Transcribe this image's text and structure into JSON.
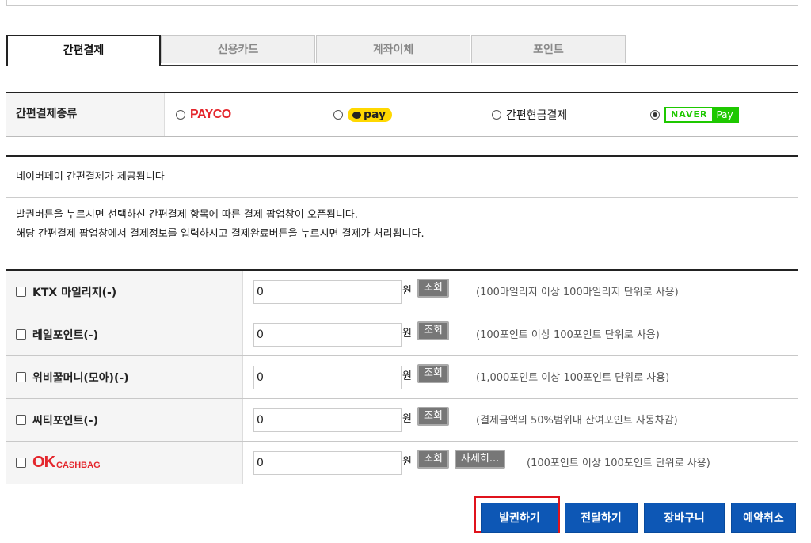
{
  "tabs": [
    {
      "label": "간편결제",
      "active": true
    },
    {
      "label": "신용카드",
      "active": false
    },
    {
      "label": "계좌이체",
      "active": false
    },
    {
      "label": "포인트",
      "active": false
    }
  ],
  "pay_type": {
    "label": "간편결제종류",
    "options": [
      {
        "name": "PAYCO",
        "selected": false
      },
      {
        "name": "pay",
        "selected": false
      },
      {
        "name": "간편현금결제",
        "selected": false
      },
      {
        "name": "NAVER Pay",
        "selected": true
      }
    ],
    "payco_text": "PAYCO",
    "kakao_text": "pay",
    "cash_text": "간편현금결제",
    "naver_left": "NAVER",
    "naver_right": "Pay"
  },
  "notice": {
    "line1": "네이버페이 간편결제가 제공됩니다",
    "line2": "발권버튼을 누르시면 선택하신 간편결제 항목에 따른 결제 팝업창이 오픈됩니다.",
    "line3": "해당 간편결제 팝업창에서 결제정보를 입력하시고 결제완료버튼을 누르시면 결제가 처리됩니다."
  },
  "points": [
    {
      "label": "KTX 마일리지(-)",
      "value": "0",
      "unit": "원",
      "query": "조회",
      "note": "(100마일리지 이상 100마일리지 단위로 사용)"
    },
    {
      "label": "레일포인트(-)",
      "value": "0",
      "unit": "원",
      "query": "조회",
      "note": "(100포인트 이상 100포인트 단위로 사용)"
    },
    {
      "label": "위비꿀머니(모아)(-)",
      "value": "0",
      "unit": "원",
      "query": "조회",
      "note": "(1,000포인트 이상 100포인트 단위로 사용)"
    },
    {
      "label": "씨티포인트(-)",
      "value": "0",
      "unit": "원",
      "query": "조회",
      "note": "(결제금액의 50%범위내 잔여포인트 자동차감)"
    },
    {
      "label": "OK CASHBAG",
      "value": "0",
      "unit": "원",
      "query": "조회",
      "detail": "자세히...",
      "note": "(100포인트 이상 100포인트 단위로 사용)"
    }
  ],
  "okcashbag": {
    "o": "O",
    "k": "K",
    "rest": "CASHBAG"
  },
  "buttons": {
    "issue": "발권하기",
    "send": "전달하기",
    "cart": "장바구니",
    "cancel": "예약취소"
  },
  "colors": {
    "primary_button": "#0d57b5",
    "highlight": "#e0131c",
    "naver_green": "#1ec800",
    "kakao_yellow": "#ffd800",
    "payco_red": "#e4262c"
  }
}
